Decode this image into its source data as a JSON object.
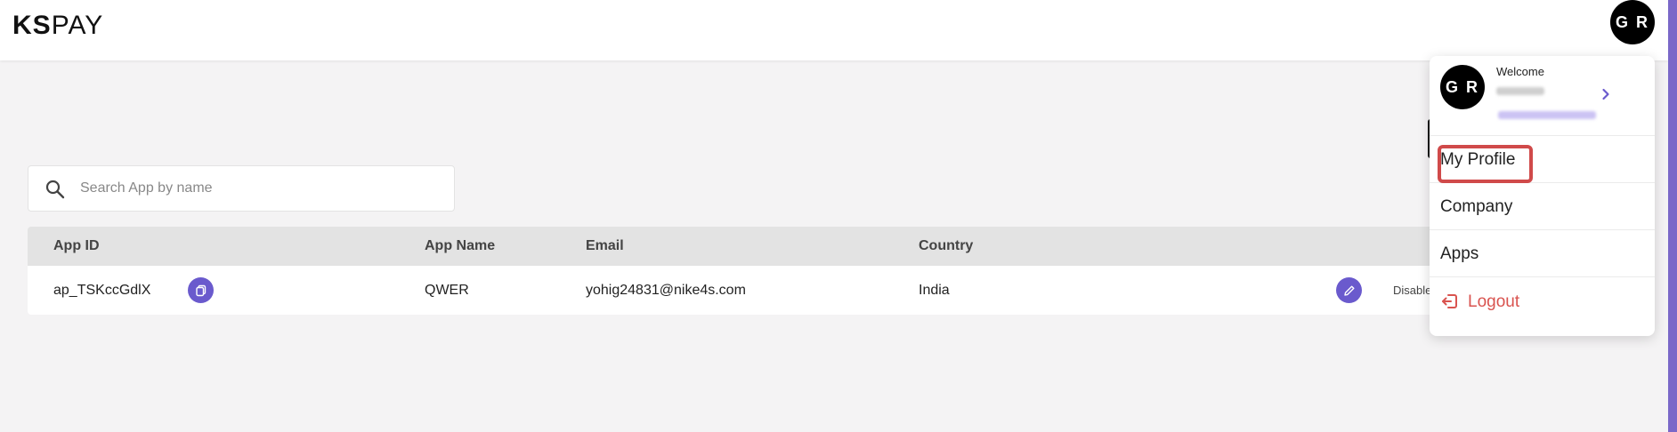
{
  "header": {
    "logo_bold": "KS",
    "logo_light": "PAY",
    "avatar_initials": "G R"
  },
  "search": {
    "placeholder": "Search App by name",
    "value": ""
  },
  "table": {
    "columns": [
      "App ID",
      "App Name",
      "Email",
      "Country"
    ],
    "rows": [
      {
        "app_id": "ap_TSKccGdlX",
        "app_name": "QWER",
        "email": "yohig24831@nike4s.com",
        "country": "India",
        "status_text": "Disable"
      }
    ]
  },
  "user_menu": {
    "avatar_initials": "G R",
    "welcome": "Welcome",
    "items": [
      {
        "label": "My Profile"
      },
      {
        "label": "Company"
      },
      {
        "label": "Apps"
      },
      {
        "label": "Logout"
      }
    ]
  },
  "colors": {
    "accent": "#6a5acd",
    "logout": "#d9534f",
    "highlight": "#d04a4a",
    "header_bg": "#ffffff",
    "page_bg": "#f4f3f4",
    "table_head": "#e3e3e3"
  },
  "icons": [
    "search-icon",
    "copy-icon",
    "edit-icon",
    "chevron-right-icon",
    "logout-icon"
  ]
}
